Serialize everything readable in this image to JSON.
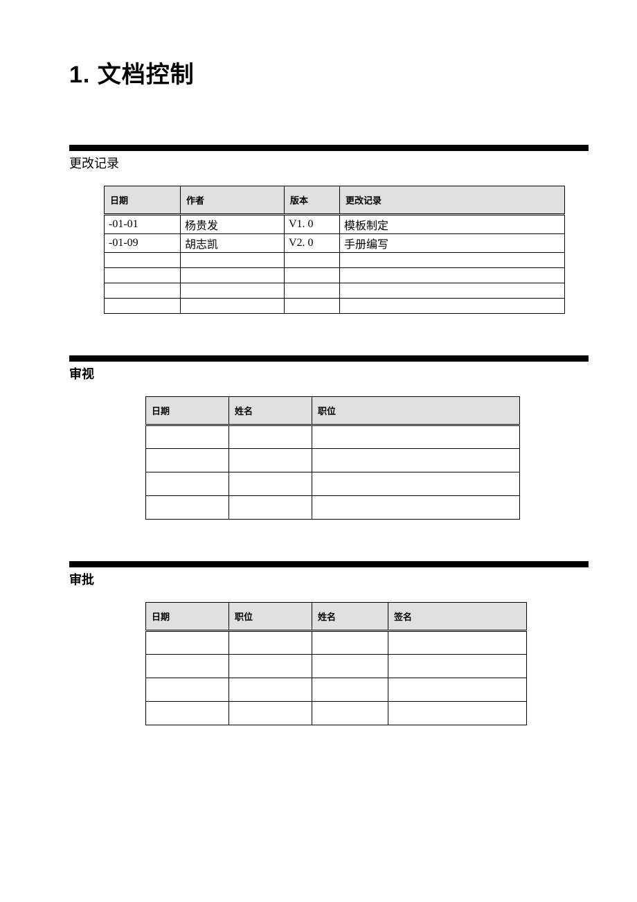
{
  "title": "1. 文档控制",
  "section1": {
    "label": "更改记录",
    "headers": [
      "日期",
      "作者",
      "版本",
      "更改记录"
    ],
    "rows": [
      {
        "date": "-01-01",
        "author": "杨贵发",
        "version": "V1. 0",
        "note": "模板制定"
      },
      {
        "date": "-01-09",
        "author": "胡志凯",
        "version": "V2. 0",
        "note": "手册编写"
      },
      {
        "date": "",
        "author": "",
        "version": "",
        "note": ""
      },
      {
        "date": "",
        "author": "",
        "version": "",
        "note": ""
      },
      {
        "date": "",
        "author": "",
        "version": "",
        "note": ""
      },
      {
        "date": "",
        "author": "",
        "version": "",
        "note": ""
      }
    ]
  },
  "section2": {
    "label": "审视",
    "headers": [
      "日期",
      "姓名",
      "职位"
    ],
    "rows": [
      {
        "date": "",
        "name": "",
        "title": ""
      },
      {
        "date": "",
        "name": "",
        "title": ""
      },
      {
        "date": "",
        "name": "",
        "title": ""
      },
      {
        "date": "",
        "name": "",
        "title": ""
      }
    ]
  },
  "section3": {
    "label": "审批",
    "headers": [
      "日期",
      "职位",
      "姓名",
      "签名"
    ],
    "rows": [
      {
        "date": "",
        "title": "",
        "name": "",
        "sign": ""
      },
      {
        "date": "",
        "title": "",
        "name": "",
        "sign": ""
      },
      {
        "date": "",
        "title": "",
        "name": "",
        "sign": ""
      },
      {
        "date": "",
        "title": "",
        "name": "",
        "sign": ""
      }
    ]
  }
}
